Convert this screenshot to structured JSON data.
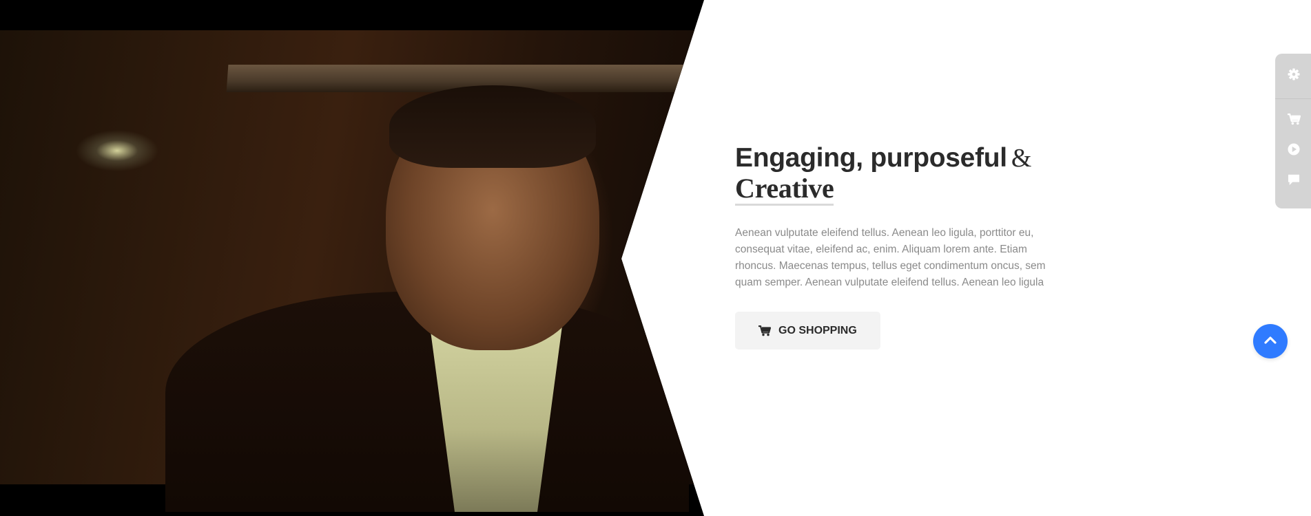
{
  "hero": {
    "video_alt": "Man in dark car interior",
    "headline_main": "Engaging, purposeful",
    "headline_amp": "&",
    "headline_accent": "Creative",
    "description": "Aenean vulputate eleifend tellus. Aenean leo ligula, porttitor eu, consequat vitae, eleifend ac, enim. Aliquam lorem ante. Etiam rhoncus. Maecenas tempus, tellus eget condimentum oncus, sem quam semper. Aenean vulputate eleifend tellus. Aenean leo ligula",
    "button_label": "GO SHOPPING",
    "button_icon": "cart-icon"
  },
  "side_panel": {
    "icons": [
      "gear-icon",
      "cart-icon",
      "play-icon",
      "comment-icon"
    ]
  },
  "back_to_top": {
    "icon": "chevron-up-icon"
  },
  "colors": {
    "accent": "#2f7bff",
    "heading": "#2b2b2b",
    "body_text": "#8a8a8a",
    "panel": "#d4d4d4",
    "button_bg": "#f3f3f3"
  }
}
